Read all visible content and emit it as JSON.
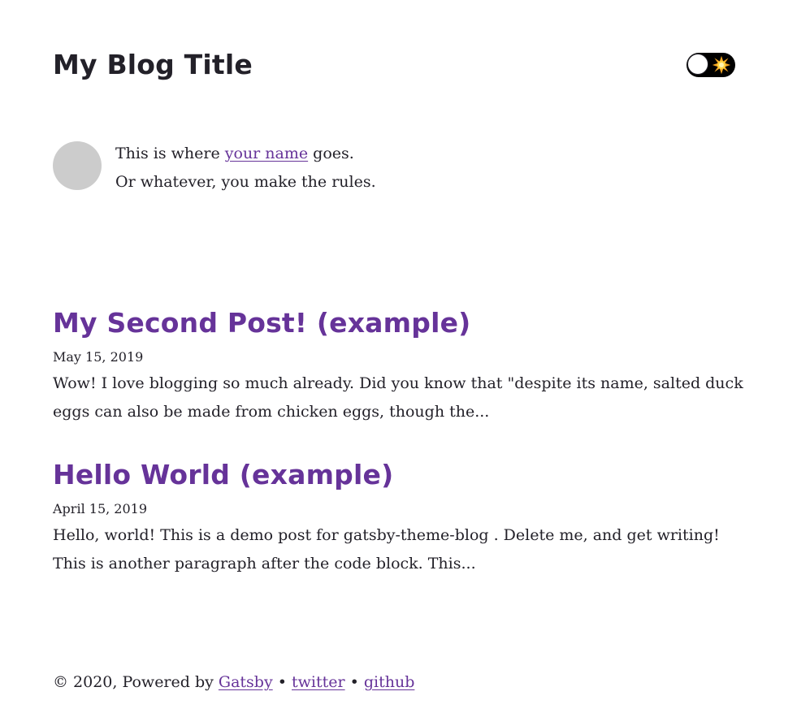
{
  "header": {
    "site_title": "My Blog Title",
    "theme_toggle": {
      "state": "light",
      "icon": "sun-icon"
    }
  },
  "bio": {
    "line1_prefix": "This is where ",
    "name_link": "your name",
    "line1_suffix": " goes.",
    "line2": "Or whatever, you make the rules."
  },
  "posts": [
    {
      "title": "My Second Post! (example)",
      "date": "May 15, 2019",
      "excerpt": "Wow! I love blogging so much already. Did you know that \"despite its name, salted duck eggs can also be made from chicken eggs, though the..."
    },
    {
      "title": "Hello World (example)",
      "date": "April 15, 2019",
      "excerpt": "Hello, world! This is a demo post for gatsby-theme-blog . Delete me, and get writing! This is another paragraph after the code block. This..."
    }
  ],
  "footer": {
    "prefix": "© 2020, Powered by ",
    "gatsby_link": "Gatsby",
    "separator1": " • ",
    "twitter_link": "twitter",
    "separator2": " • ",
    "github_link": "github"
  },
  "colors": {
    "text": "#232129",
    "link": "#663399",
    "avatar_placeholder": "#cccccc",
    "toggle_background": "#000000"
  }
}
